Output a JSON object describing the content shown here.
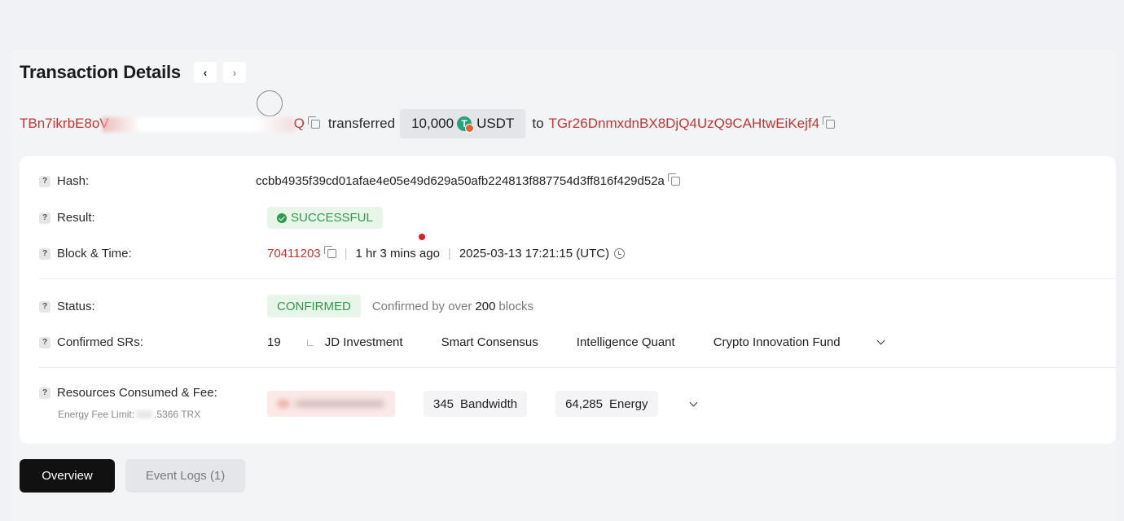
{
  "header": {
    "title": "Transaction Details",
    "prev_label": "‹",
    "next_label": "›"
  },
  "transfer": {
    "from_prefix": "TBn7ikrbE8oV",
    "from_suffix": "Q",
    "action": "transferred",
    "amount": "10,000",
    "token_symbol": "USDT",
    "to_word": "to",
    "to_address": "TGr26DnmxdnBX8DjQ4UzQ9CAHtwEiKejf4"
  },
  "details": {
    "hash_label": "Hash:",
    "hash_value": "ccbb4935f39cd01afae4e05e49d629a50afb224813f887754d3ff816f429d52a",
    "result_label": "Result:",
    "result_value": "SUCCESSFUL",
    "block_time_label": "Block & Time:",
    "block_number": "70411203",
    "time_ago": "1 hr 3 mins ago",
    "timestamp": "2025-03-13 17:21:15 (UTC)",
    "status_label": "Status:",
    "status_value": "CONFIRMED",
    "confirmed_prefix": "Confirmed by over",
    "confirmed_count": "200",
    "confirmed_suffix": "blocks",
    "srs_label": "Confirmed SRs:",
    "srs_count": "19",
    "srs": [
      "JD Investment",
      "Smart Consensus",
      "Intelligence Quant",
      "Crypto Innovation Fund"
    ],
    "resources_label": "Resources Consumed & Fee:",
    "energy_fee_limit_prefix": "Energy Fee Limit:",
    "energy_fee_limit_suffix": ".5366 TRX",
    "bandwidth_value": "345",
    "bandwidth_unit": "Bandwidth",
    "energy_value": "64,285",
    "energy_unit": "Energy"
  },
  "tabs": {
    "overview": "Overview",
    "event_logs": "Event Logs (1)"
  },
  "colors": {
    "address_red": "#c23631",
    "success_green": "#2e9b48",
    "tab_active_bg": "#111111"
  }
}
